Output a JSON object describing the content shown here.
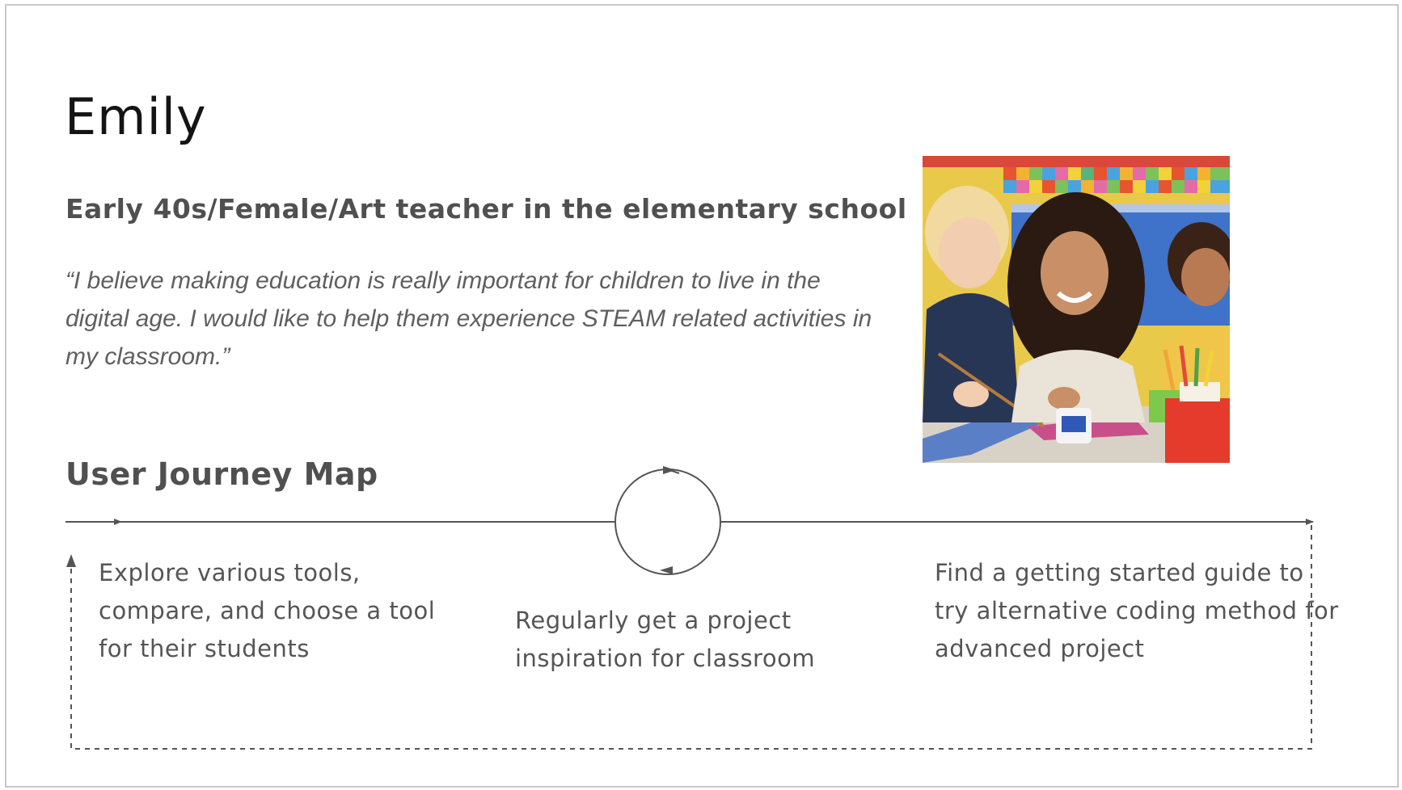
{
  "persona": {
    "name": "Emily",
    "subtitle": "Early 40s/Female/Art teacher in the elementary school",
    "quote": "“I believe making education is really important for children to live in the digital age. I would like to help them experience STEAM related activities in my classroom.”",
    "photo_subject": "teacher painting with children in classroom"
  },
  "journey": {
    "title": "User Journey Map",
    "steps": [
      {
        "text": "Explore various tools, compare, and choose a tool for their students"
      },
      {
        "text": "Regularly get a project inspiration for classroom"
      },
      {
        "text": "Find a getting started guide to try alternative coding method for advanced project"
      }
    ],
    "loop_icon": "cycle-loop-icon"
  },
  "colors": {
    "line": "#555555",
    "heading": "#505050",
    "frame_border": "#c8c8c8"
  }
}
